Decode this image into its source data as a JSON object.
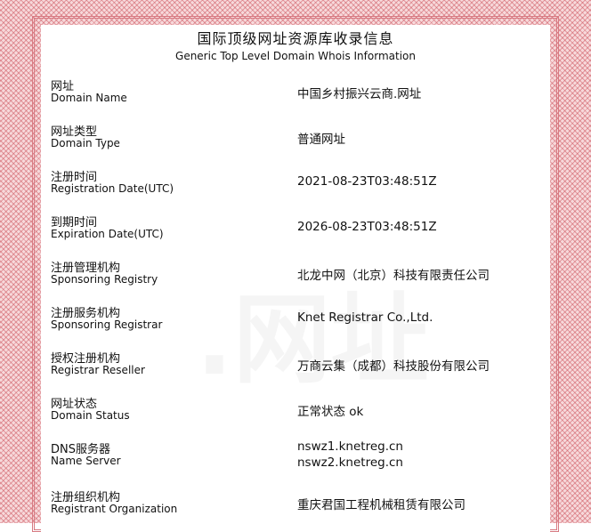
{
  "header": {
    "title_cn": "国际顶级网址资源库收录信息",
    "title_en": "Generic Top Level Domain Whois Information"
  },
  "rows": [
    {
      "label_cn": "网址",
      "label_en": "Domain Name",
      "value": "中国乡村振兴云商.网址"
    },
    {
      "label_cn": "网址类型",
      "label_en": "Domain Type",
      "value": "普通网址"
    },
    {
      "label_cn": "注册时间",
      "label_en": "Registration Date(UTC)",
      "value": "2021-08-23T03:48:51Z"
    },
    {
      "label_cn": "到期时间",
      "label_en": "Expiration Date(UTC)",
      "value": "2026-08-23T03:48:51Z"
    },
    {
      "label_cn": "注册管理机构",
      "label_en": "Sponsoring Registry",
      "value": "北龙中网（北京）科技有限责任公司"
    },
    {
      "label_cn": "注册服务机构",
      "label_en": "Sponsoring Registrar",
      "value": "Knet Registrar Co.,Ltd."
    },
    {
      "label_cn": "授权注册机构",
      "label_en": "Registrar Reseller",
      "value": "万商云集（成都）科技股份有限公司"
    },
    {
      "label_cn": "网址状态",
      "label_en": "Domain Status",
      "value": "正常状态 ok"
    },
    {
      "label_cn": "DNS服务器",
      "label_en": "Name Server",
      "value1": "nswz1.knetreg.cn",
      "value2": "nswz2.knetreg.cn"
    },
    {
      "label_cn": "注册组织机构",
      "label_en": "Registrant Organization",
      "value": "重庆君国工程机械租赁有限公司"
    }
  ],
  "watermark": {
    "text": ".网址"
  }
}
